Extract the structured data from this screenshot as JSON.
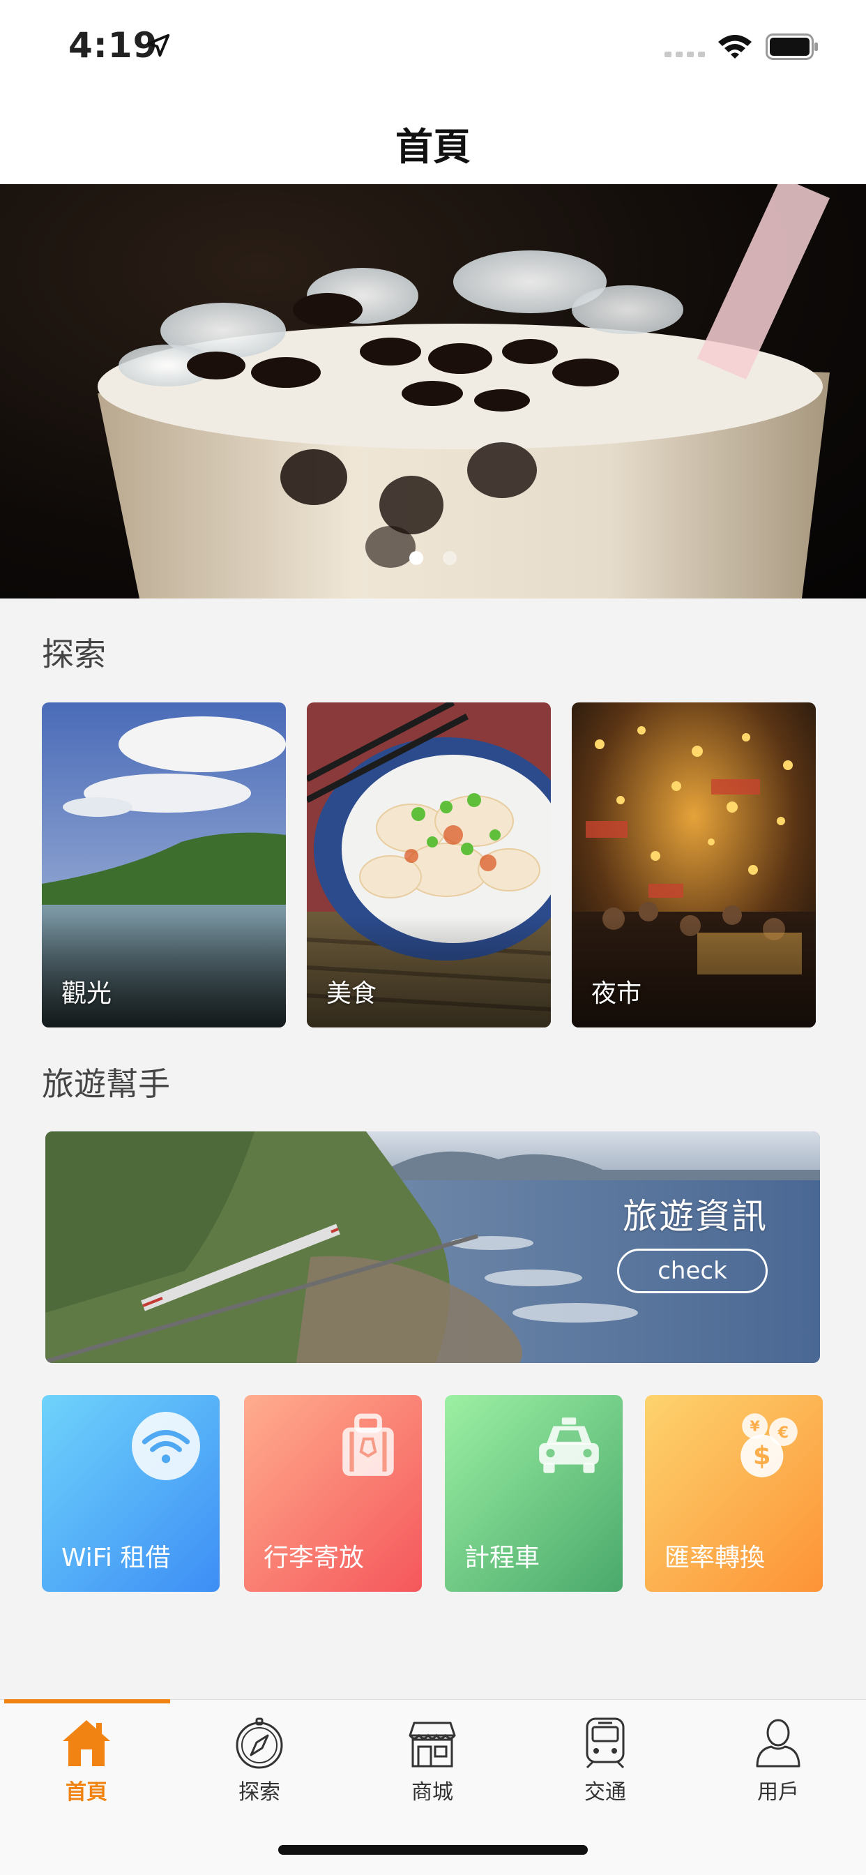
{
  "status": {
    "time": "4:19",
    "icons": [
      "location-arrow-icon",
      "signal-dots-icon",
      "wifi-icon",
      "battery-icon"
    ]
  },
  "nav": {
    "title": "首頁"
  },
  "hero": {
    "image": "bubble-tea-photo",
    "pages": 2,
    "active_page": 1
  },
  "explore": {
    "title": "探索",
    "cards": [
      {
        "label": "觀光",
        "image": "coastal-landscape-photo"
      },
      {
        "label": "美食",
        "image": "wonton-dish-photo"
      },
      {
        "label": "夜市",
        "image": "night-market-photo"
      }
    ]
  },
  "helper": {
    "title": "旅遊幫手",
    "banner": {
      "title": "旅遊資訊",
      "button_label": "check",
      "image": "coastal-train-photo"
    },
    "tiles": [
      {
        "label": "WiFi 租借",
        "icon": "wifi-icon",
        "colors": [
          "#6fd3fb",
          "#3d8ef5"
        ]
      },
      {
        "label": "行李寄放",
        "icon": "luggage-icon",
        "colors": [
          "#ffad8e",
          "#f5575b"
        ]
      },
      {
        "label": "計程車",
        "icon": "taxi-icon",
        "colors": [
          "#9cf0a3",
          "#4aa96b"
        ]
      },
      {
        "label": "匯率轉換",
        "icon": "currency-exchange-icon",
        "colors": [
          "#fdd36e",
          "#fd9336"
        ]
      }
    ]
  },
  "tabbar": {
    "active": "首頁",
    "accent": "#f08312",
    "tabs": [
      {
        "label": "首頁",
        "icon": "home-icon"
      },
      {
        "label": "探索",
        "icon": "compass-icon"
      },
      {
        "label": "商城",
        "icon": "store-icon"
      },
      {
        "label": "交通",
        "icon": "train-icon"
      },
      {
        "label": "用戶",
        "icon": "user-icon"
      }
    ]
  }
}
